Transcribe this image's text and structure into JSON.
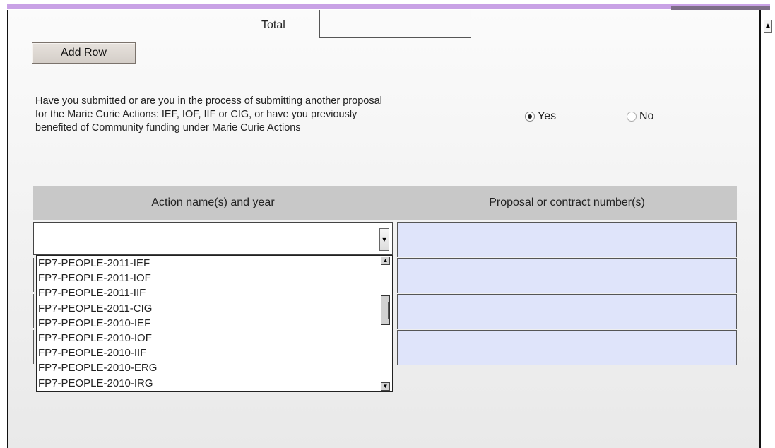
{
  "total": {
    "label": "Total",
    "value": ""
  },
  "add_row": {
    "label": "Add Row"
  },
  "question": {
    "lines": [
      "Have you submitted or are you in the process of submitting another proposal",
      "for the Marie Curie Actions: IEF, IOF, IIF or CIG, or have you previously",
      "benefited of Community funding under Marie Curie Actions"
    ],
    "options": [
      {
        "label": "Yes",
        "checked": true
      },
      {
        "label": "No",
        "checked": false
      }
    ]
  },
  "table": {
    "columns": [
      "Action name(s) and year",
      "Proposal or contract number(s)"
    ],
    "action_select": {
      "value": ""
    },
    "proposal_values": [
      "",
      "",
      "",
      ""
    ]
  },
  "dropdown": {
    "items": [
      "FP7-PEOPLE-2011-IEF",
      "FP7-PEOPLE-2011-IOF",
      "FP7-PEOPLE-2011-IIF",
      "FP7-PEOPLE-2011-CIG",
      "FP7-PEOPLE-2010-IEF",
      "FP7-PEOPLE-2010-IOF",
      "FP7-PEOPLE-2010-IIF",
      "FP7-PEOPLE-2010-ERG",
      "FP7-PEOPLE-2010-IRG"
    ]
  },
  "colors": {
    "accent": "#c9a2e6",
    "field_bg": "#dfe4fa",
    "header_bg": "#c8c8c8"
  },
  "icons": {
    "radio_selected": "radio-selected-icon",
    "dropdown_arrow": "chevron-down-icon"
  }
}
